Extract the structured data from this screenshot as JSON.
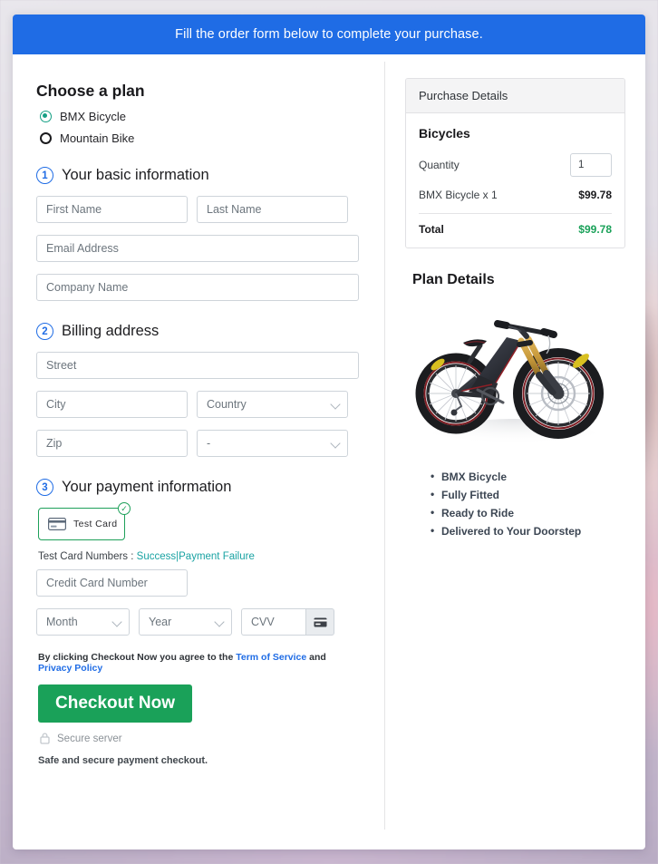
{
  "banner": {
    "text": "Fill the order form below to complete your purchase."
  },
  "plan": {
    "heading": "Choose a plan",
    "options": [
      {
        "label": "BMX Bicycle",
        "selected": true
      },
      {
        "label": "Mountain Bike",
        "selected": false
      }
    ]
  },
  "steps": {
    "basic": {
      "number": "1",
      "title": "Your basic information",
      "fields": {
        "first_name": "First Name",
        "last_name": "Last Name",
        "email": "Email Address",
        "company": "Company Name"
      }
    },
    "billing": {
      "number": "2",
      "title": "Billing address",
      "fields": {
        "street": "Street",
        "city": "City",
        "country": "Country",
        "zip": "Zip",
        "state": "-"
      }
    },
    "payment": {
      "number": "3",
      "title": "Your payment information",
      "card_option": "Test  Card",
      "card_selected_badge": "✓",
      "test_numbers_label": "Test Card Numbers :",
      "test_numbers_success": "Success",
      "test_numbers_separator": "|",
      "test_numbers_failure": "Payment Failure",
      "fields": {
        "credit_card": "Credit Card Number",
        "month": "Month",
        "year": "Year",
        "cvv": "CVV"
      }
    }
  },
  "footer": {
    "agree_prefix": "By clicking Checkout Now you agree to the",
    "terms_link": "Term of Service",
    "agree_and": "and",
    "privacy_link": "Privacy Policy",
    "checkout_label": "Checkout Now",
    "secure_server": "Secure server",
    "safe_note": "Safe and secure payment checkout."
  },
  "purchase": {
    "header": "Purchase Details",
    "group_title": "Bicycles",
    "quantity_label": "Quantity",
    "quantity_value": "1",
    "line_item_label": "BMX Bicycle x 1",
    "line_item_amount": "$99.78",
    "total_label": "Total",
    "total_amount": "$99.78"
  },
  "plan_details": {
    "title": "Plan Details",
    "image_alt": "mountain-bike-photo",
    "features": [
      "BMX Bicycle",
      "Fully Fitted",
      "Ready to Ride",
      "Delivered to Your Doorstep"
    ]
  },
  "colors": {
    "banner_blue": "#1f6ce5",
    "accent_green": "#1aa159",
    "radio_green": "#16a085",
    "link_teal": "#1aa3a3",
    "link_blue": "#1f6ce5"
  }
}
